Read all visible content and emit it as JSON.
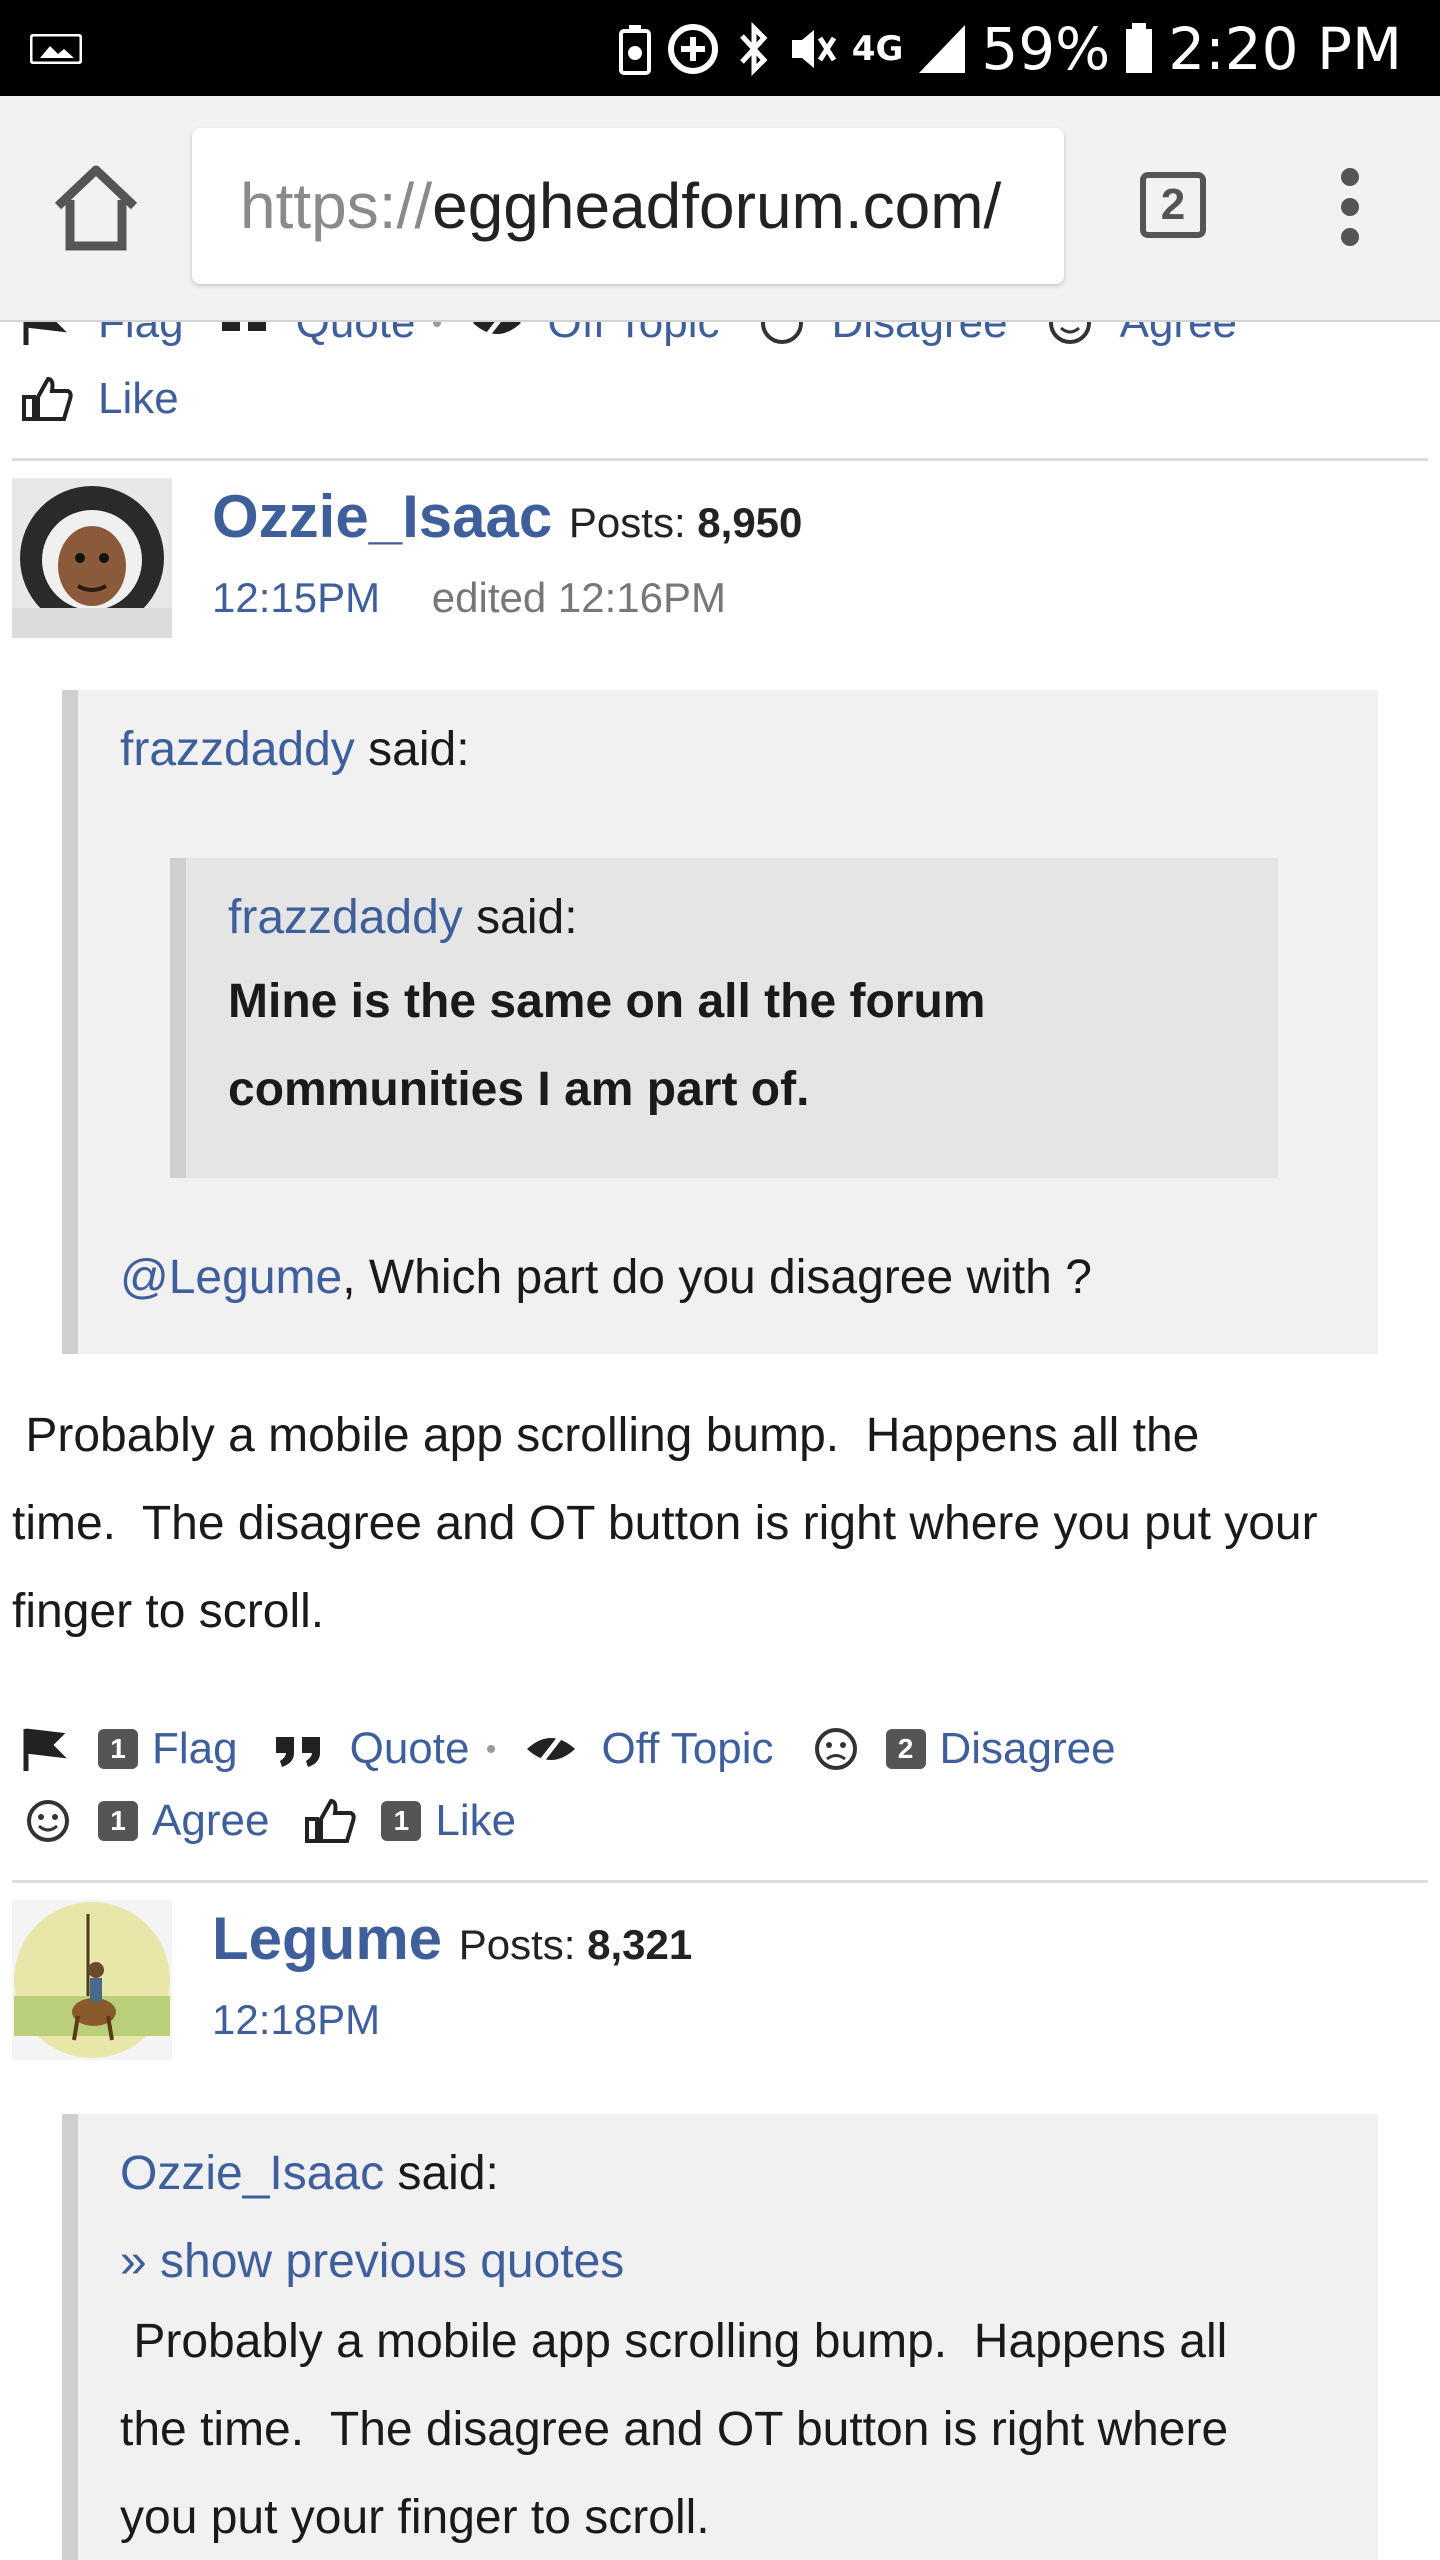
{
  "status_bar": {
    "battery": "59%",
    "time": "2:20 PM",
    "network": "4G"
  },
  "browser": {
    "url_scheme": "https://",
    "url_host": "eggheadforum.com/",
    "tab_count": "2"
  },
  "top_reactions": {
    "flag": "Flag",
    "quote": "Quote",
    "off_topic": "Off Topic",
    "disagree": "Disagree",
    "agree": "Agree",
    "like": "Like"
  },
  "post1": {
    "author": "Ozzie_Isaac",
    "posts_label": "Posts:",
    "posts_count": "8,950",
    "time": "12:15PM",
    "edited": "edited 12:16PM",
    "outer_quote_author": "frazzdaddy",
    "said": "said:",
    "inner_quote_author": "frazzdaddy",
    "inner_quote_line1": "Mine is the same on all the forum",
    "inner_quote_line2": "communities I am part of.",
    "mention": "@Legume",
    "outer_quote_text": ", Which part do you disagree with ?",
    "body_line1": " Probably a mobile app scrolling bump.  Happens all the",
    "body_line2": "time.  The disagree and OT button is right where you put your",
    "body_line3": "finger to scroll.",
    "reactions": {
      "flag_count": "1",
      "flag": "Flag",
      "quote": "Quote",
      "off_topic": "Off Topic",
      "disagree_count": "2",
      "disagree": "Disagree",
      "agree_count": "1",
      "agree": "Agree",
      "like_count": "1",
      "like": "Like"
    }
  },
  "post2": {
    "author": "Legume",
    "posts_label": "Posts:",
    "posts_count": "8,321",
    "time": "12:18PM",
    "quote_author": "Ozzie_Isaac",
    "said": "said:",
    "show_previous": "» show previous quotes",
    "quote_line1": " Probably a mobile app scrolling bump.  Happens all",
    "quote_line2": "the time.  The disagree and OT button is right where",
    "quote_line3": "you put your finger to scroll."
  }
}
